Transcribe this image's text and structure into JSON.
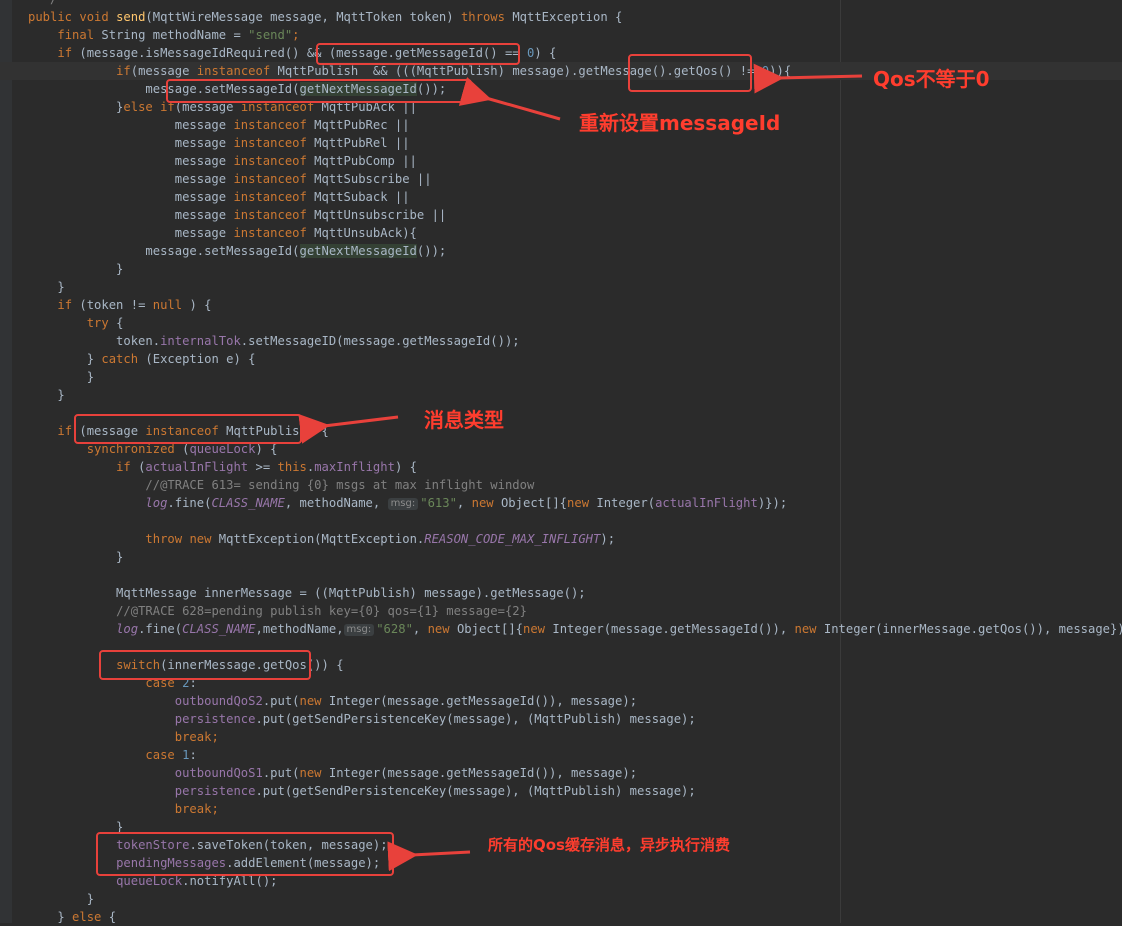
{
  "code_lines": [
    {
      "tokens": [
        {
          "t": "  */",
          "c": "cmt"
        }
      ]
    },
    {
      "tokens": [
        {
          "t": "public ",
          "c": "kw"
        },
        {
          "t": "void ",
          "c": "kw"
        },
        {
          "t": "send",
          "c": "mth"
        },
        {
          "t": "(MqttWireMessage message, MqttToken token) "
        },
        {
          "t": "throws ",
          "c": "kw"
        },
        {
          "t": "MqttException {"
        }
      ]
    },
    {
      "tokens": [
        {
          "t": "    "
        },
        {
          "t": "final ",
          "c": "kw"
        },
        {
          "t": "String methodName = "
        },
        {
          "t": "\"send\"",
          "c": "str"
        },
        {
          "t": ";",
          "c": "kw"
        }
      ]
    },
    {
      "tokens": [
        {
          "t": "    "
        },
        {
          "t": "if ",
          "c": "kw"
        },
        {
          "t": "(message.isMessageIdRequired() && (message.getMessageId() == "
        },
        {
          "t": "0",
          "c": "num"
        },
        {
          "t": ") {"
        }
      ]
    },
    {
      "current": true,
      "tokens": [
        {
          "t": "            "
        },
        {
          "t": "if",
          "c": "kw"
        },
        {
          "t": "(message "
        },
        {
          "t": "instanceof ",
          "c": "kw"
        },
        {
          "t": "MqttPublish  && (((MqttPublish) message).getMessage().getQos() != "
        },
        {
          "t": "0",
          "c": "num"
        },
        {
          "t": ")){"
        }
      ]
    },
    {
      "tokens": [
        {
          "t": "                message.setMessageId("
        },
        {
          "t": "getNextMessageId",
          "c": "hl"
        },
        {
          "t": "());"
        }
      ]
    },
    {
      "tokens": [
        {
          "t": "            }"
        },
        {
          "t": "else if",
          "c": "kw"
        },
        {
          "t": "(message "
        },
        {
          "t": "instanceof ",
          "c": "kw"
        },
        {
          "t": "MqttPubAck ||"
        }
      ]
    },
    {
      "tokens": [
        {
          "t": "                    message "
        },
        {
          "t": "instanceof ",
          "c": "kw"
        },
        {
          "t": "MqttPubRec ||"
        }
      ]
    },
    {
      "tokens": [
        {
          "t": "                    message "
        },
        {
          "t": "instanceof ",
          "c": "kw"
        },
        {
          "t": "MqttPubRel ||"
        }
      ]
    },
    {
      "tokens": [
        {
          "t": "                    message "
        },
        {
          "t": "instanceof ",
          "c": "kw"
        },
        {
          "t": "MqttPubComp ||"
        }
      ]
    },
    {
      "tokens": [
        {
          "t": "                    message "
        },
        {
          "t": "instanceof ",
          "c": "kw"
        },
        {
          "t": "MqttSubscribe ||"
        }
      ]
    },
    {
      "tokens": [
        {
          "t": "                    message "
        },
        {
          "t": "instanceof ",
          "c": "kw"
        },
        {
          "t": "MqttSuback ||"
        }
      ]
    },
    {
      "tokens": [
        {
          "t": "                    message "
        },
        {
          "t": "instanceof ",
          "c": "kw"
        },
        {
          "t": "MqttUnsubscribe ||"
        }
      ]
    },
    {
      "tokens": [
        {
          "t": "                    message "
        },
        {
          "t": "instanceof ",
          "c": "kw"
        },
        {
          "t": "MqttUnsubAck){"
        }
      ]
    },
    {
      "tokens": [
        {
          "t": "                message.setMessageId("
        },
        {
          "t": "getNextMessageId",
          "c": "hl"
        },
        {
          "t": "());"
        }
      ]
    },
    {
      "tokens": [
        {
          "t": "            }"
        }
      ]
    },
    {
      "tokens": [
        {
          "t": "    }"
        }
      ]
    },
    {
      "tokens": [
        {
          "t": "    "
        },
        {
          "t": "if ",
          "c": "kw"
        },
        {
          "t": "(token != "
        },
        {
          "t": "null ",
          "c": "kw"
        },
        {
          "t": ") {"
        }
      ]
    },
    {
      "tokens": [
        {
          "t": "        "
        },
        {
          "t": "try ",
          "c": "kw"
        },
        {
          "t": "{"
        }
      ]
    },
    {
      "tokens": [
        {
          "t": "            token."
        },
        {
          "t": "internalTok",
          "c": "fld"
        },
        {
          "t": ".setMessageID(message.getMessageId());"
        }
      ]
    },
    {
      "tokens": [
        {
          "t": "        } "
        },
        {
          "t": "catch ",
          "c": "kw"
        },
        {
          "t": "(Exception e) {"
        }
      ]
    },
    {
      "tokens": [
        {
          "t": "        }"
        }
      ]
    },
    {
      "tokens": [
        {
          "t": "    }"
        }
      ]
    },
    {
      "tokens": [
        {
          "t": ""
        }
      ]
    },
    {
      "tokens": [
        {
          "t": "    "
        },
        {
          "t": "if ",
          "c": "kw"
        },
        {
          "t": "(message "
        },
        {
          "t": "instanceof ",
          "c": "kw"
        },
        {
          "t": "MqttPublish) {"
        }
      ]
    },
    {
      "tokens": [
        {
          "t": "        "
        },
        {
          "t": "synchronized ",
          "c": "kw"
        },
        {
          "t": "("
        },
        {
          "t": "queueLock",
          "c": "fld"
        },
        {
          "t": ") {"
        }
      ]
    },
    {
      "tokens": [
        {
          "t": "            "
        },
        {
          "t": "if ",
          "c": "kw"
        },
        {
          "t": "("
        },
        {
          "t": "actualInFlight",
          "c": "fld"
        },
        {
          "t": " >= "
        },
        {
          "t": "this",
          "c": "kw"
        },
        {
          "t": "."
        },
        {
          "t": "maxInflight",
          "c": "fld"
        },
        {
          "t": ") {"
        }
      ]
    },
    {
      "tokens": [
        {
          "t": "                "
        },
        {
          "t": "//@TRACE 613= sending {0} msgs at max inflight window",
          "c": "cmt"
        }
      ]
    },
    {
      "tokens": [
        {
          "t": "                "
        },
        {
          "t": "log",
          "c": "sfld"
        },
        {
          "t": ".fine("
        },
        {
          "t": "CLASS_NAME",
          "c": "sfld"
        },
        {
          "t": ", methodName, "
        },
        {
          "t": "msg:",
          "c": "hint"
        },
        {
          "t": "\"613\"",
          "c": "str"
        },
        {
          "t": ", "
        },
        {
          "t": "new ",
          "c": "kw"
        },
        {
          "t": "Object[]{"
        },
        {
          "t": "new ",
          "c": "kw"
        },
        {
          "t": "Integer("
        },
        {
          "t": "actualInFlight",
          "c": "fld"
        },
        {
          "t": ")});"
        }
      ]
    },
    {
      "tokens": [
        {
          "t": ""
        }
      ]
    },
    {
      "tokens": [
        {
          "t": "                "
        },
        {
          "t": "throw ",
          "c": "kw"
        },
        {
          "t": "new ",
          "c": "kw"
        },
        {
          "t": "MqttException(MqttException."
        },
        {
          "t": "REASON_CODE_MAX_INFLIGHT",
          "c": "sfld"
        },
        {
          "t": ");"
        }
      ]
    },
    {
      "tokens": [
        {
          "t": "            }"
        }
      ]
    },
    {
      "tokens": [
        {
          "t": ""
        }
      ]
    },
    {
      "tokens": [
        {
          "t": "            MqttMessage innerMessage = ((MqttPublish) message).getMessage();"
        }
      ]
    },
    {
      "tokens": [
        {
          "t": "            "
        },
        {
          "t": "//@TRACE 628=pending publish key={0} qos={1} message={2}",
          "c": "cmt"
        }
      ]
    },
    {
      "tokens": [
        {
          "t": "            "
        },
        {
          "t": "log",
          "c": "sfld"
        },
        {
          "t": ".fine("
        },
        {
          "t": "CLASS_NAME",
          "c": "sfld"
        },
        {
          "t": ",methodName,"
        },
        {
          "t": "msg:",
          "c": "hint"
        },
        {
          "t": "\"628\"",
          "c": "str"
        },
        {
          "t": ", "
        },
        {
          "t": "new ",
          "c": "kw"
        },
        {
          "t": "Object[]{"
        },
        {
          "t": "new ",
          "c": "kw"
        },
        {
          "t": "Integer(message.getMessageId()), "
        },
        {
          "t": "new ",
          "c": "kw"
        },
        {
          "t": "Integer(innerMessage.getQos()), message});"
        }
      ]
    },
    {
      "tokens": [
        {
          "t": ""
        }
      ]
    },
    {
      "tokens": [
        {
          "t": "            "
        },
        {
          "t": "switch",
          "c": "kw"
        },
        {
          "t": "(innerMessage.getQos()) {"
        }
      ]
    },
    {
      "tokens": [
        {
          "t": "                "
        },
        {
          "t": "case ",
          "c": "kw"
        },
        {
          "t": "2",
          "c": "num"
        },
        {
          "t": ":"
        }
      ]
    },
    {
      "tokens": [
        {
          "t": "                    "
        },
        {
          "t": "outboundQoS2",
          "c": "fld"
        },
        {
          "t": ".put("
        },
        {
          "t": "new ",
          "c": "kw"
        },
        {
          "t": "Integer(message.getMessageId()), message);"
        }
      ]
    },
    {
      "tokens": [
        {
          "t": "                    "
        },
        {
          "t": "persistence",
          "c": "fld"
        },
        {
          "t": ".put(getSendPersistenceKey(message), (MqttPublish) message);"
        }
      ]
    },
    {
      "tokens": [
        {
          "t": "                    "
        },
        {
          "t": "break",
          "c": "kw"
        },
        {
          "t": ";",
          "c": "kw"
        }
      ]
    },
    {
      "tokens": [
        {
          "t": "                "
        },
        {
          "t": "case ",
          "c": "kw"
        },
        {
          "t": "1",
          "c": "num"
        },
        {
          "t": ":"
        }
      ]
    },
    {
      "tokens": [
        {
          "t": "                    "
        },
        {
          "t": "outboundQoS1",
          "c": "fld"
        },
        {
          "t": ".put("
        },
        {
          "t": "new ",
          "c": "kw"
        },
        {
          "t": "Integer(message.getMessageId()), message);"
        }
      ]
    },
    {
      "tokens": [
        {
          "t": "                    "
        },
        {
          "t": "persistence",
          "c": "fld"
        },
        {
          "t": ".put(getSendPersistenceKey(message), (MqttPublish) message);"
        }
      ]
    },
    {
      "tokens": [
        {
          "t": "                    "
        },
        {
          "t": "break",
          "c": "kw"
        },
        {
          "t": ";",
          "c": "kw"
        }
      ]
    },
    {
      "tokens": [
        {
          "t": "            }"
        }
      ]
    },
    {
      "tokens": [
        {
          "t": "            "
        },
        {
          "t": "tokenStore",
          "c": "fld"
        },
        {
          "t": ".saveToken(token, message);"
        }
      ]
    },
    {
      "tokens": [
        {
          "t": "            "
        },
        {
          "t": "pendingMessages",
          "c": "fld"
        },
        {
          "t": ".addElement(message);"
        }
      ]
    },
    {
      "tokens": [
        {
          "t": "            "
        },
        {
          "t": "queueLock",
          "c": "fld"
        },
        {
          "t": ".notifyAll();"
        }
      ]
    },
    {
      "tokens": [
        {
          "t": "        }"
        }
      ]
    },
    {
      "tokens": [
        {
          "t": "    } "
        },
        {
          "t": "else ",
          "c": "kw"
        },
        {
          "t": "{"
        }
      ]
    }
  ],
  "annotations": {
    "qos_label": "Qos不等于0",
    "reset_id_label": "重新设置messageId",
    "msg_type_label": "消息类型",
    "cache_label": "所有的Qos缓存消息，异步执行消费"
  },
  "colors": {
    "annotation": "#ff3d2e",
    "background": "#2b2b2b",
    "keyword": "#cc7832",
    "string": "#6a8759",
    "number": "#6897bb",
    "field": "#9876aa",
    "comment": "#808080"
  }
}
